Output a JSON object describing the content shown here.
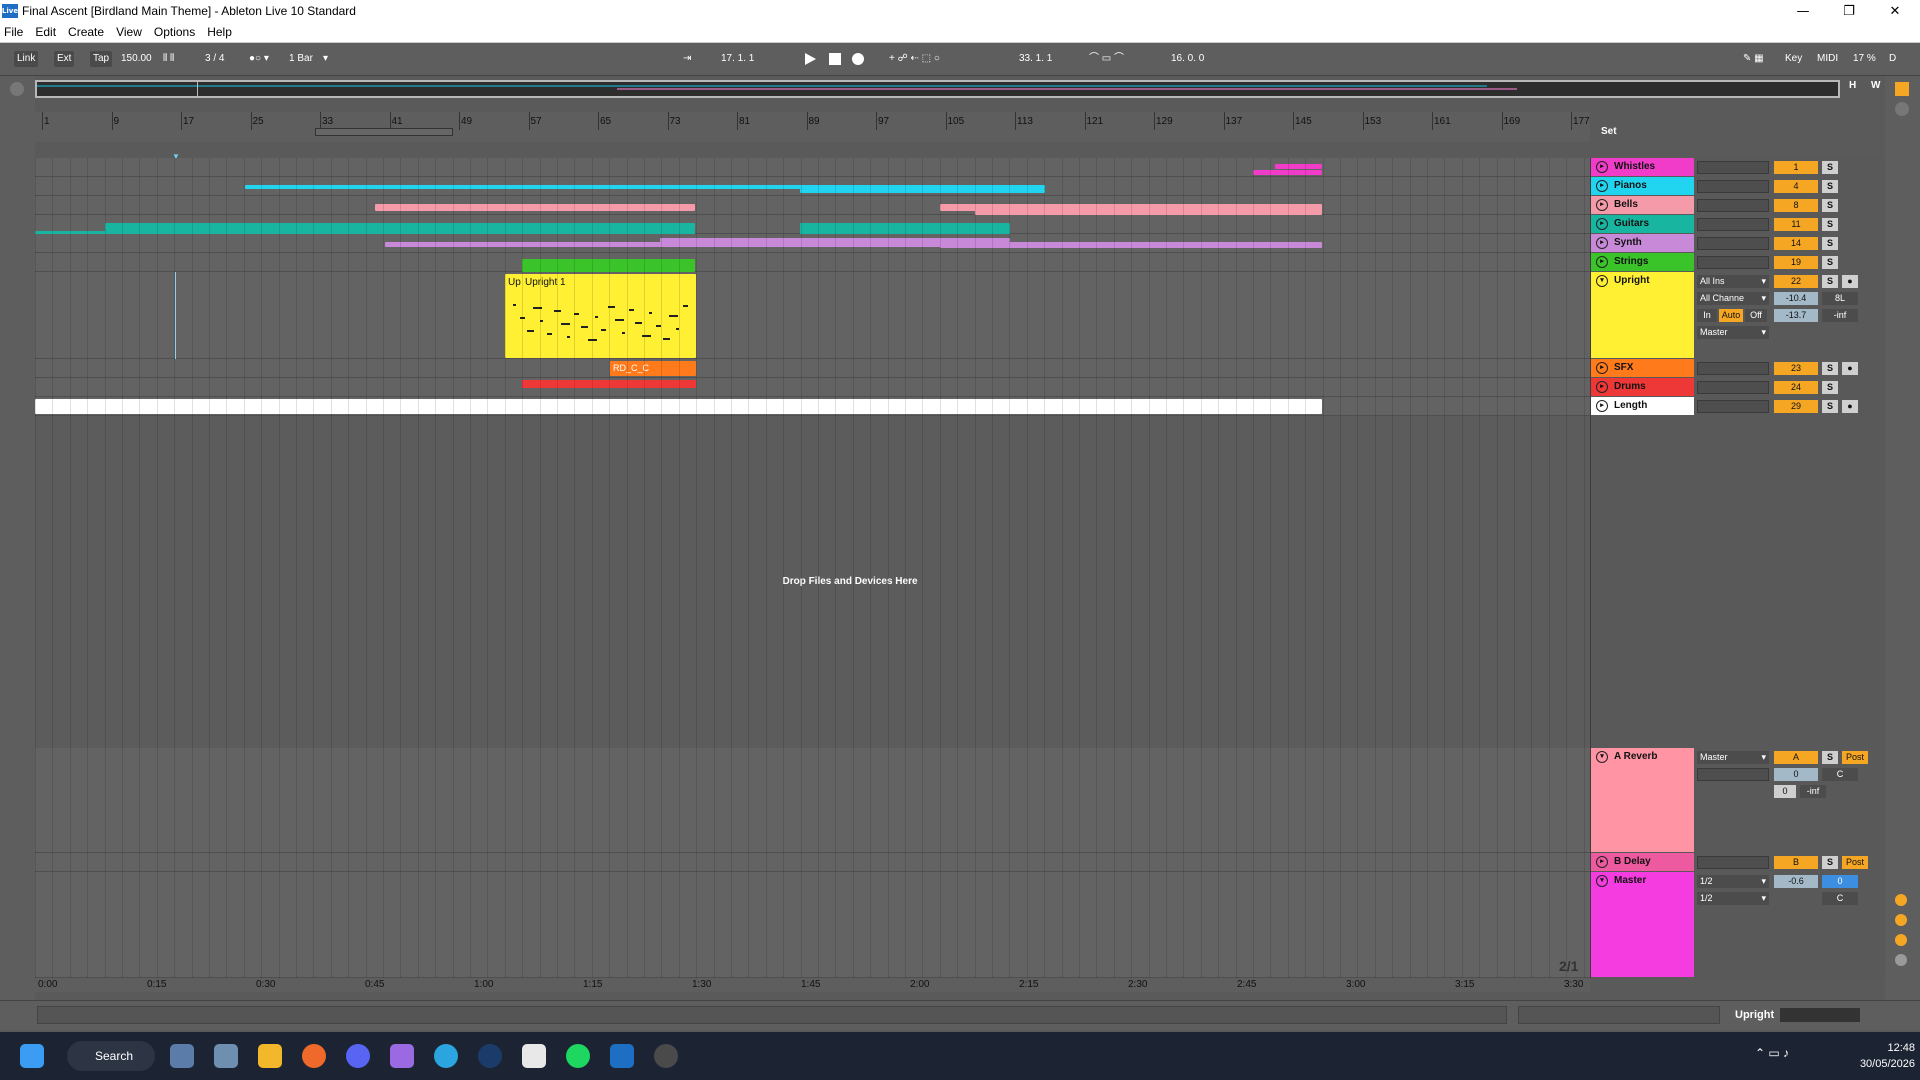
{
  "window": {
    "title": "Final Ascent  [Birdland Main Theme] - Ableton Live 10 Standard",
    "logo": "Live",
    "minimize": "—",
    "maximize": "❐",
    "close": "✕"
  },
  "menu": [
    "File",
    "Edit",
    "Create",
    "View",
    "Options",
    "Help"
  ],
  "toolbar": {
    "link": "Link",
    "ext": "Ext",
    "tap": "Tap",
    "tempo": "150.00",
    "signature": "3 / 4",
    "quantize": "1 Bar",
    "position": "17.  1.  1",
    "loop_start": "33.  1.  1",
    "loop_length": "16.  0.  0",
    "key": "Key",
    "midi": "MIDI",
    "cpu": "17 %",
    "d": "D"
  },
  "overview_buttons": {
    "h": "H",
    "w": "W"
  },
  "ruler": [
    "1",
    "9",
    "17",
    "25",
    "33",
    "41",
    "49",
    "57",
    "65",
    "73",
    "81",
    "89",
    "97",
    "105",
    "113",
    "121",
    "129",
    "137",
    "145",
    "153",
    "161",
    "169",
    "177"
  ],
  "timeline": [
    "0:00",
    "0:15",
    "0:30",
    "0:45",
    "1:00",
    "1:15",
    "1:30",
    "1:45",
    "2:00",
    "2:15",
    "2:30",
    "2:45",
    "3:00",
    "3:15",
    "3:30"
  ],
  "set_label": "Set",
  "drop_hint": "Drop Files and Devices Here",
  "page_indicator": "2/1",
  "tracks": [
    {
      "name": "Whistles",
      "color": "#f03cc8",
      "num": "1"
    },
    {
      "name": "Pianos",
      "color": "#21d4f0",
      "num": "4"
    },
    {
      "name": "Bells",
      "color": "#f49aa8",
      "num": "8"
    },
    {
      "name": "Guitars",
      "color": "#18b6a0",
      "num": "11"
    },
    {
      "name": "Synth",
      "color": "#c88ad8",
      "num": "14"
    },
    {
      "name": "Strings",
      "color": "#3bc42a",
      "num": "19"
    },
    {
      "name": "Upright",
      "color": "#fff033",
      "num": "22",
      "input": "All Ins",
      "channel": "All Channe",
      "vol": "-10.4",
      "pan": "8L",
      "mon_in": "In",
      "mon_auto": "Auto",
      "mon_off": "Off",
      "peak": "-13.7",
      "peak2": "-inf",
      "output": "Master"
    },
    {
      "name": "SFX",
      "color": "#ff7a1a",
      "num": "23"
    },
    {
      "name": "Drums",
      "color": "#ee3838",
      "num": "24"
    },
    {
      "name": "Length",
      "color": "#ffffff",
      "num": "29"
    }
  ],
  "clips": {
    "upright_a": "Up",
    "upright_b": "Upright 1",
    "sfx": "RD_C_C"
  },
  "returns": [
    {
      "name": "A Reverb",
      "color": "#ff94a4",
      "num": "A",
      "output": "Master",
      "post": "Post",
      "vol": "0",
      "pan": "C",
      "peak": "0",
      "peak2": "-inf"
    },
    {
      "name": "B Delay",
      "color": "#ee5aa0",
      "num": "B",
      "post": "Post"
    }
  ],
  "master": {
    "name": "Master",
    "color": "#f53ce0",
    "cue": "1/2",
    "out": "1/2",
    "vol": "-0.6",
    "val": "0",
    "pan": "C"
  },
  "bottom": {
    "selected_track": "Upright"
  },
  "taskbar": {
    "search": "Search",
    "time": "12:48",
    "date": "30/05/2026"
  }
}
